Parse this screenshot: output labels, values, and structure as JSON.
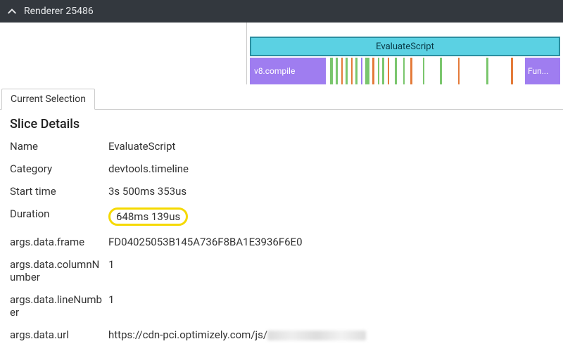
{
  "header": {
    "title": "Renderer 25486"
  },
  "timeline": {
    "main_label": "EvaluateScript",
    "v8_label": "v8.compile",
    "fun_label": "Fun..."
  },
  "tabs": {
    "current": "Current Selection"
  },
  "details": {
    "heading": "Slice Details",
    "rows": {
      "name_k": "Name",
      "name_v": "EvaluateScript",
      "category_k": "Category",
      "category_v": "devtools.timeline",
      "start_k": "Start time",
      "start_v": "3s 500ms 353us",
      "duration_k": "Duration",
      "duration_v": "648ms 139us",
      "frame_k": "args.data.frame",
      "frame_v": "FD04025053B145A736F8BA1E3936F6E0",
      "col_k": "args.data.columnNumber",
      "col_v": "1",
      "line_k": "args.data.lineNumber",
      "line_v": "1",
      "url_k": "args.data.url",
      "url_v": "https://cdn-pci.optimizely.com/js/"
    }
  }
}
